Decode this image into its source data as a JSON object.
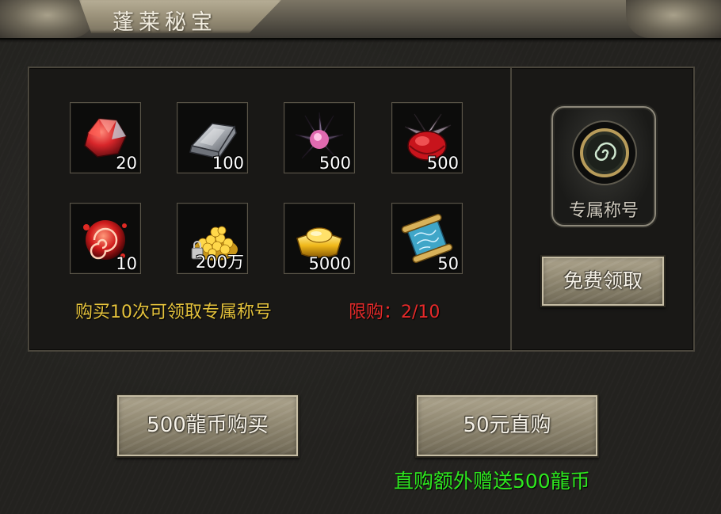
{
  "window": {
    "title": "蓬莱秘宝"
  },
  "items": [
    {
      "name": "red-crystal-icon",
      "count": "20"
    },
    {
      "name": "iron-ingot-icon",
      "count": "100"
    },
    {
      "name": "dark-flower-icon",
      "count": "500"
    },
    {
      "name": "red-flower-icon",
      "count": "500"
    },
    {
      "name": "red-orb-icon",
      "count": "10"
    },
    {
      "name": "gold-coin-pile-icon",
      "count": "200万"
    },
    {
      "name": "gold-ingot-icon",
      "count": "5000"
    },
    {
      "name": "scroll-icon",
      "count": "50"
    }
  ],
  "info": {
    "reward_hint": "购买10次可领取专属称号",
    "limit": "限购：2/10"
  },
  "title_reward": {
    "label": "专属称号",
    "claim_button": "免费领取"
  },
  "purchase": {
    "coin_button": "500龍币购买",
    "direct_button": "50元直购",
    "bonus_text": "直购额外赠送500龍币"
  },
  "colors": {
    "hint_yellow": "#e4c23c",
    "limit_red": "#e62a2a",
    "bonus_green": "#2ee81f"
  }
}
